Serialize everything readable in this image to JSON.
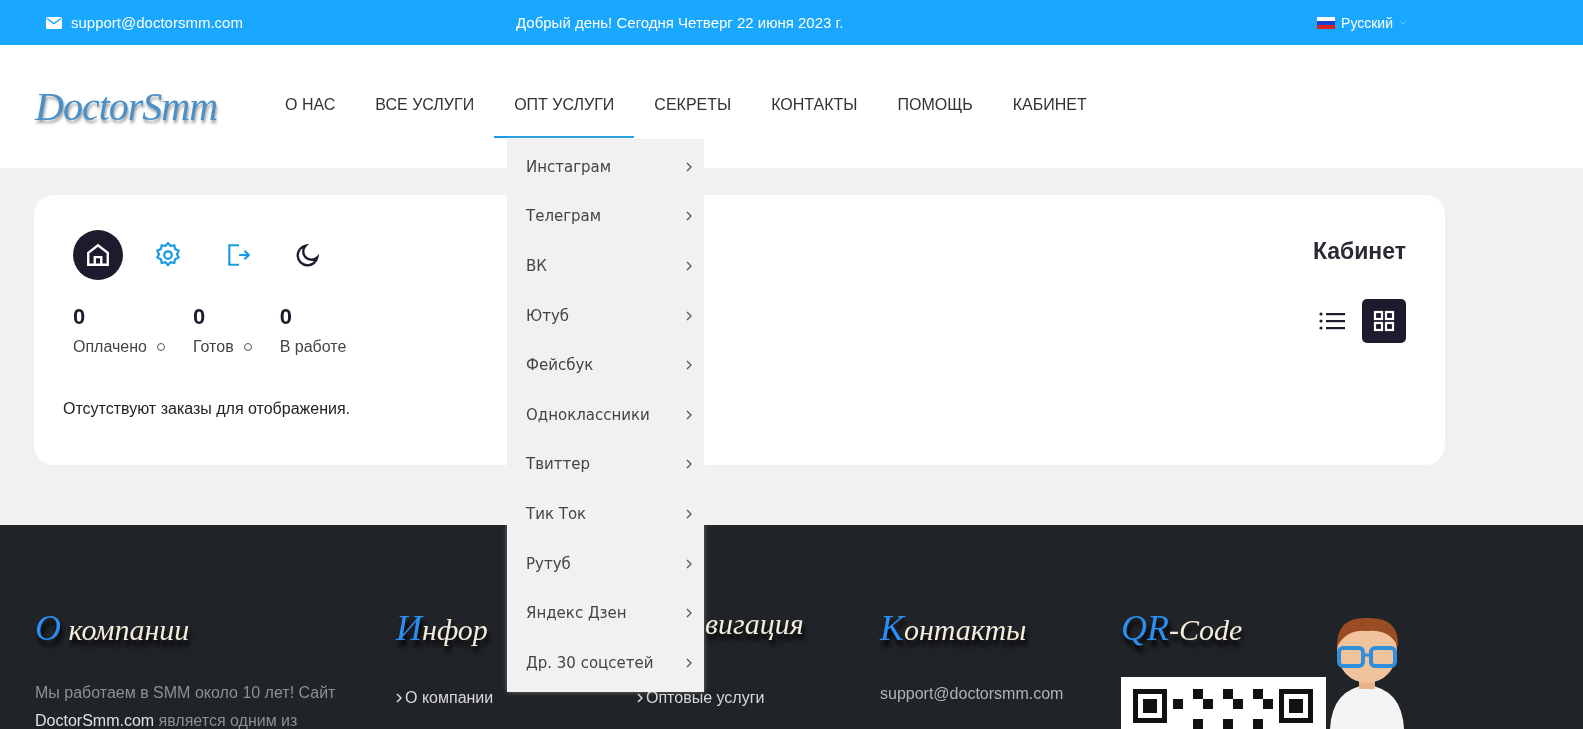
{
  "top_bar": {
    "email": "support@doctorsmm.com",
    "greeting": "Добрый день! Сегодня Четверг 22 июня 2023 г.",
    "language": "Русский"
  },
  "header": {
    "logo": "DoctorSmm",
    "nav": [
      {
        "label": "О НАС",
        "expanded": false
      },
      {
        "label": "ВСЕ УСЛУГИ",
        "expanded": false
      },
      {
        "label": "ОПТ УСЛУГИ",
        "expanded": true
      },
      {
        "label": "СЕКРЕТЫ",
        "expanded": false
      },
      {
        "label": "КОНТАКТЫ",
        "expanded": false
      },
      {
        "label": "ПОМОЩЬ",
        "expanded": false
      },
      {
        "label": "КАБИНЕТ",
        "expanded": false
      }
    ]
  },
  "dropdown": [
    "Инстаграм",
    "Телеграм",
    "ВК",
    "Ютуб",
    "Фейсбук",
    "Одноклассники",
    "Твиттер",
    "Тик Ток",
    "Рутуб",
    "Яндекс Дзен",
    "Др. 30 соцсетей"
  ],
  "cabinet": {
    "title": "Кабинет",
    "tools": [
      {
        "kind": "home",
        "selected": true
      },
      {
        "kind": "settings",
        "selected": false
      },
      {
        "kind": "logout",
        "selected": false
      },
      {
        "kind": "theme",
        "selected": false
      }
    ],
    "stats": [
      {
        "value": "0",
        "label": "Оплачено"
      },
      {
        "value": "0",
        "label": "Готов"
      },
      {
        "value": "0",
        "label": "В работе"
      }
    ],
    "message": "Отсутствуют заказы для отображения.",
    "views": [
      {
        "kind": "list",
        "selected": false
      },
      {
        "kind": "grid",
        "selected": true
      }
    ]
  },
  "footer": {
    "columns": [
      {
        "heading": {
          "accent": "О",
          "text": " компании"
        },
        "kind": "text",
        "lines": [
          "Мы работаем в SMM около 10 лет! Сайт"
        ],
        "link": "DoctorSmm.com",
        "after": " является одним из"
      },
      {
        "heading": {
          "accent": "И",
          "text": "нфор"
        },
        "kind": "links",
        "links": [
          "О компании"
        ]
      },
      {
        "heading": {
          "text": "вигация"
        },
        "kind": "links",
        "links": [
          "Оптовые услуги"
        ]
      },
      {
        "heading": {
          "accent": "К",
          "text": "онтакты"
        },
        "kind": "plain",
        "lines": [
          "support@doctorsmm.com"
        ]
      },
      {
        "heading": {
          "accent": "QR",
          "text": "-Code"
        },
        "kind": "qr"
      }
    ]
  }
}
